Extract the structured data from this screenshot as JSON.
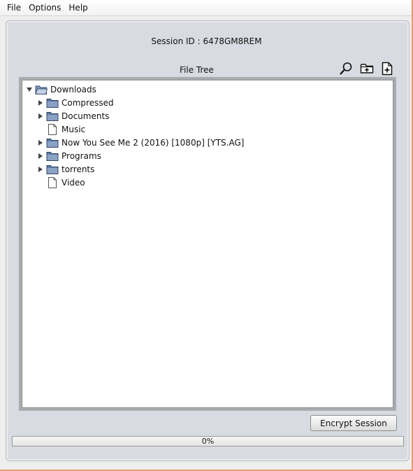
{
  "menu": {
    "items": [
      "File",
      "Options",
      "Help"
    ]
  },
  "session": {
    "label": "Session ID : 6478GM8REM"
  },
  "file_tree": {
    "title": "File Tree",
    "toolbar_icons": [
      "search-icon",
      "new-folder-icon",
      "new-file-icon"
    ],
    "root": {
      "label": "Downloads",
      "expanded": true,
      "type": "folder"
    },
    "children": [
      {
        "label": "Compressed",
        "type": "folder",
        "expandable": true
      },
      {
        "label": "Documents",
        "type": "folder",
        "expandable": true
      },
      {
        "label": "Music",
        "type": "file",
        "expandable": false
      },
      {
        "label": "Now You See Me 2 (2016) [1080p] [YTS.AG]",
        "type": "folder",
        "expandable": true
      },
      {
        "label": "Programs",
        "type": "folder",
        "expandable": true
      },
      {
        "label": "torrents",
        "type": "folder",
        "expandable": true
      },
      {
        "label": "Video",
        "type": "file",
        "expandable": false
      }
    ]
  },
  "actions": {
    "encrypt_label": "Encrypt Session"
  },
  "progress": {
    "text": "0%",
    "fraction": 0
  },
  "colors": {
    "frame_accent": "#e8996e",
    "panel_bg": "#d8dbe1",
    "folder": "#7f97bb"
  }
}
